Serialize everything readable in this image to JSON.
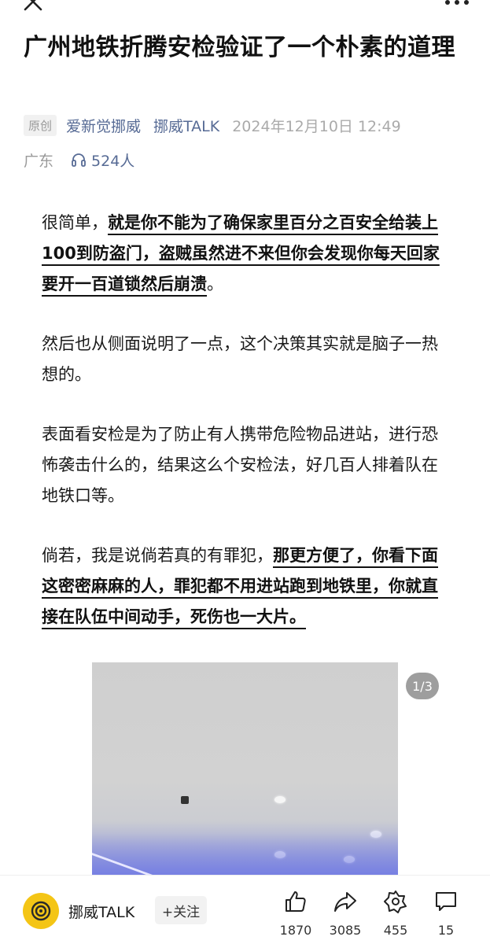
{
  "nav": {
    "close_icon": "close-icon",
    "more_icon": "more-icon"
  },
  "article": {
    "title": "广州地铁折腾安检验证了一个朴素的道理",
    "original_badge": "原创",
    "author": "爱新觉挪威",
    "account": "挪威TALK",
    "datetime": "2024年12月10日 12:49",
    "region": "广东",
    "listeners": "524人",
    "paragraphs": [
      {
        "plain": "很简单，",
        "bold": "就是你不能为了确保家里百分之百安全给装上100到防盗门，盗贼虽然进不来但你会发现你每天回家要开一百道锁然后崩溃",
        "tail": "。"
      },
      {
        "plain": "然后也从侧面说明了一点，这个决策其实就是脑子一热想的。",
        "bold": "",
        "tail": ""
      },
      {
        "plain": "表面看安检是为了防止有人携带危险物品进站，进行恐怖袭击什么的，结果这么个安检法，好几百人排着队在地铁口等。",
        "bold": "",
        "tail": ""
      },
      {
        "plain": "倘若，我是说倘若真的有罪犯，",
        "bold": "那更方便了，你看下面这密密麻麻的人，罪犯都不用进站跑到地铁里，你就直接在队伍中间动手，死伤也一大片。",
        "tail": ""
      }
    ],
    "image_indicator": "1/3"
  },
  "bottombar": {
    "account_name": "挪威TALK",
    "follow_label": "+关注",
    "like_count": "1870",
    "share_count": "3085",
    "star_count": "455",
    "comment_count": "15"
  },
  "colors": {
    "link": "#576b95",
    "avatar": "#f4c515",
    "muted": "#aaaaaa"
  }
}
